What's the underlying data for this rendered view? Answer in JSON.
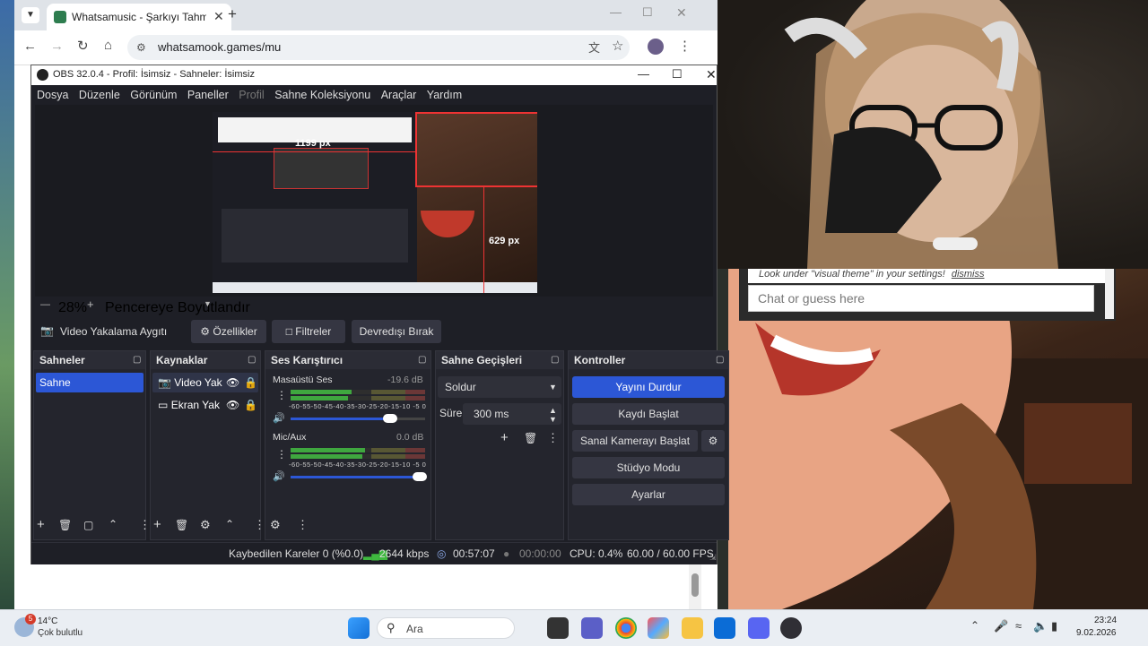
{
  "browser": {
    "tab_title": "Whatsamusic - Şarkıyı Tahmin E",
    "url": "whatsamook.games/mu"
  },
  "obs": {
    "window_title": "OBS 32.0.4 - Profil: İsimsiz - Sahneler: İsimsiz",
    "menu": [
      "Dosya",
      "Düzenle",
      "Görünüm",
      "Paneller",
      "Profil",
      "Sahne Koleksiyonu",
      "Araçlar",
      "Yardım"
    ],
    "preview": {
      "size_label_1": "1199 px",
      "size_label_2": "629 px",
      "zoom": "28%",
      "zoom_mode": "Pencereye Boyutlandır"
    },
    "source_toolbar": {
      "source_name": "Video Yakalama Aygıtı",
      "properties": "Özellikler",
      "filters": "Filtreler",
      "deactivate": "Devredışı Bırak"
    },
    "scenes": {
      "title": "Sahneler",
      "items": [
        "Sahne"
      ]
    },
    "sources": {
      "title": "Kaynaklar",
      "items": [
        "Video Yak",
        "Ekran Yak"
      ]
    },
    "mixer": {
      "title": "Ses Karıştırıcı",
      "channels": [
        {
          "name": "Masaüstü Ses",
          "db": "-19.6 dB",
          "level": 0.45,
          "volume": 0.78
        },
        {
          "name": "Mic/Aux",
          "db": "0.0 dB",
          "level": 0.55,
          "volume": 1.0
        }
      ],
      "scale": "-60-55-50-45-40-35-30-25-20-15-10 -5 0"
    },
    "transitions": {
      "title": "Sahne Geçişleri",
      "selected": "Soldur",
      "duration_label": "Süre",
      "duration_value": "300 ms"
    },
    "controls": {
      "title": "Kontroller",
      "buttons": [
        "Yayını Durdur",
        "Kaydı Başlat",
        "Sanal Kamerayı Başlat",
        "Stüdyo Modu",
        "Ayarlar"
      ]
    },
    "status": {
      "dropped": "Kaybedilen Kareler 0 (%0.0)",
      "bitrate": "2644 kbps",
      "stream_time": "00:57:07",
      "rec_time": "00:00:00",
      "cpu": "CPU: 0.4%",
      "fps": "60.00 / 60.00 FPS"
    }
  },
  "chat": {
    "notice": "Look under \"visual theme\" in your settings!",
    "dismiss": "dismiss",
    "input_placeholder": "Chat or guess here"
  },
  "taskbar": {
    "weather_badge": "5",
    "temperature": "14°C",
    "weather_desc": "Çok bulutlu",
    "search_placeholder": "Ara",
    "time": "23:24",
    "date": "9.02.2026"
  },
  "colors": {
    "obs_accent": "#2c57d6",
    "obs_bg": "#1e1f26"
  }
}
